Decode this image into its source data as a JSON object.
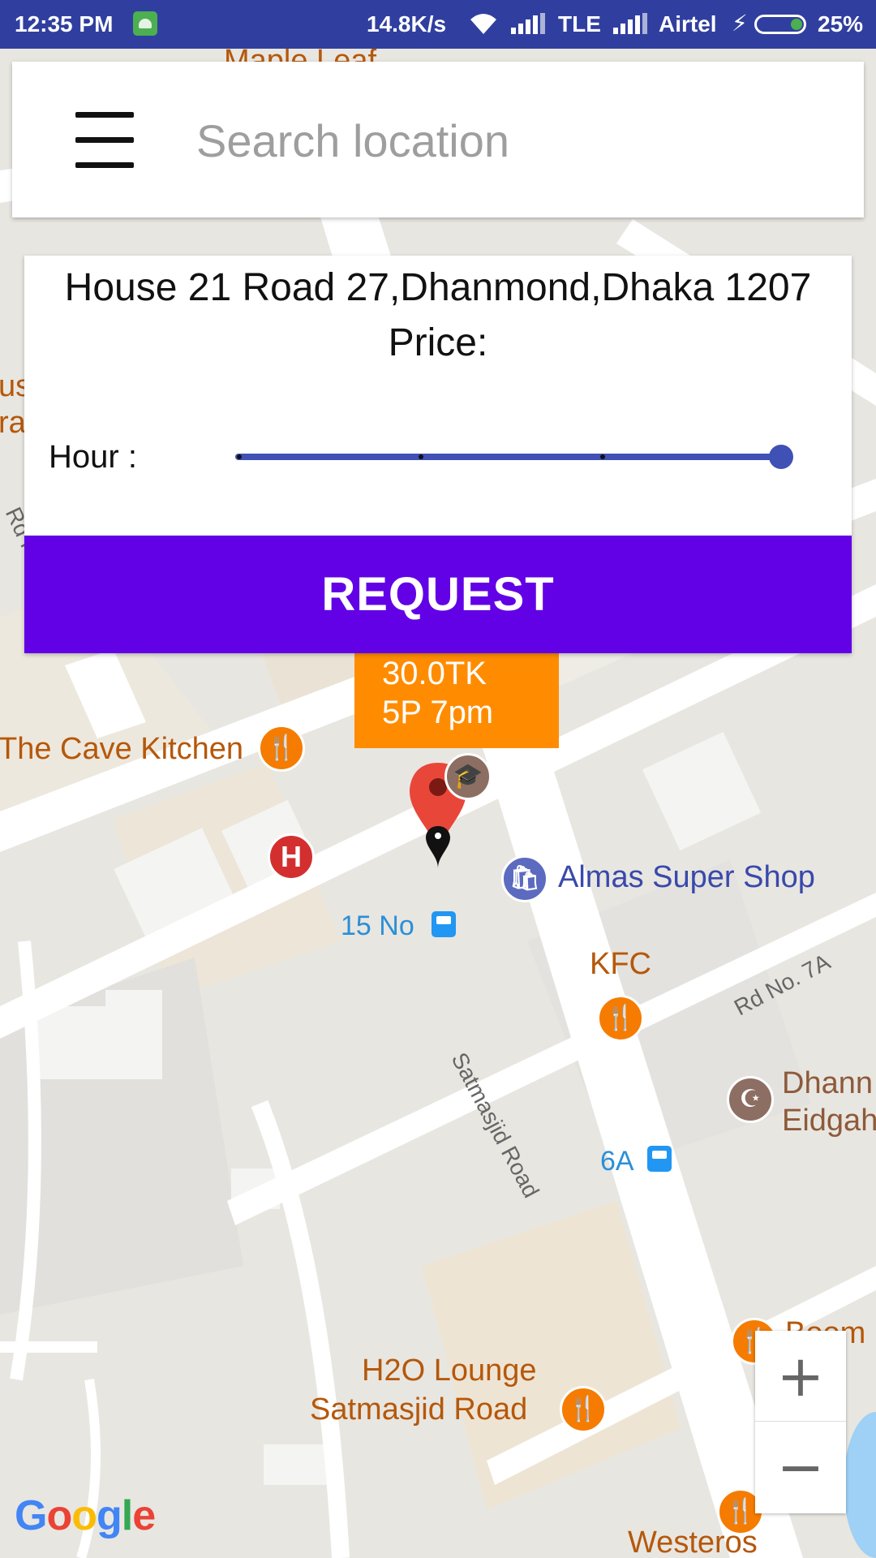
{
  "status_bar": {
    "time": "12:35 PM",
    "net_speed": "14.8K/s",
    "net_type": "TLE",
    "carrier": "Airtel",
    "battery": "25%"
  },
  "search": {
    "placeholder": "Search location"
  },
  "info_card": {
    "address": "House 21 Road 27,Dhanmond,Dhaka 1207",
    "price_label": "Price:",
    "hour_label": "Hour :",
    "hour_slider_fraction": 1.0,
    "request_label": "REQUEST"
  },
  "marker_info": {
    "price": "30.0TK",
    "time": "5P    7pm"
  },
  "map_labels": {
    "maple_leaf": "Maple Leaf",
    "cave_kitchen": "The Cave Kitchen",
    "almas": "Almas Super Shop",
    "bus_15": "15 No",
    "kfc": "KFC",
    "satmasjid_road": "Satmasjid Road",
    "rd_7a": "Rd No. 7A",
    "eidgah_1": "Dhann",
    "eidgah_2": "Eidgah",
    "bus_6a": "6A",
    "boom": "Boom",
    "h2o_1": "H2O Lounge",
    "h2o_2": "Satmasjid Road",
    "westeros": "Westeros",
    "rd_left": "Rd N",
    "left_partial_1": "us",
    "left_partial_2": "ra"
  },
  "zoom": {
    "in": "+",
    "out": "−"
  },
  "colors": {
    "status_bar": "#303f9f",
    "request_button": "#6200e6",
    "slider": "#3f51b5",
    "marker_info": "#ff8c00"
  }
}
